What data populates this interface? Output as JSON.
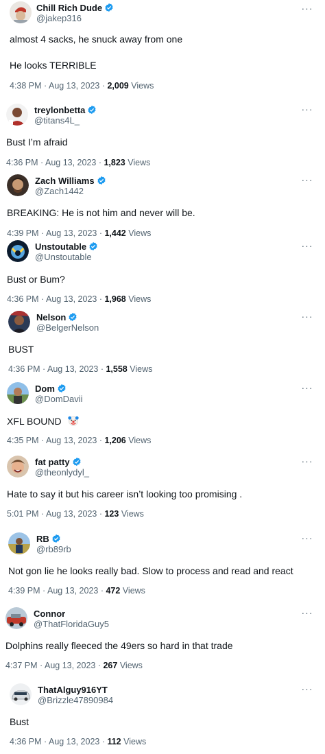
{
  "colors": {
    "verified": "#1d9bf0",
    "secondary": "#536471",
    "text": "#0f1419"
  },
  "icons": {
    "verified": "verified-badge-icon",
    "more": "more-options-icon"
  },
  "tweets": [
    {
      "name": "Chill Rich Dude",
      "handle": "@jakep316",
      "verified": true,
      "lines": [
        "almost 4 sacks, he snuck away from one",
        "He looks TERRIBLE"
      ],
      "time": "4:38 PM",
      "date": "Aug 13, 2023",
      "views": "2,009",
      "views_label": "Views"
    },
    {
      "name": "treylonbetta",
      "handle": "@titans4L_",
      "verified": true,
      "lines": [
        "Bust I’m afraid"
      ],
      "time": "4:36 PM",
      "date": "Aug 13, 2023",
      "views": "1,823",
      "views_label": "Views"
    },
    {
      "name": "Zach Williams",
      "handle": "@Zach1442",
      "verified": true,
      "lines": [
        "BREAKING: He is not him and never will be."
      ],
      "time": "4:39 PM",
      "date": "Aug 13, 2023",
      "views": "1,442",
      "views_label": "Views"
    },
    {
      "name": "Unstoutable",
      "handle": "@Unstoutable",
      "verified": true,
      "lines": [
        "Bust or Bum?"
      ],
      "time": "4:36 PM",
      "date": "Aug 13, 2023",
      "views": "1,968",
      "views_label": "Views"
    },
    {
      "name": "Nelson",
      "handle": "@BelgerNelson",
      "verified": true,
      "lines": [
        "BUST"
      ],
      "time": "4:36 PM",
      "date": "Aug 13, 2023",
      "views": "1,558",
      "views_label": "Views"
    },
    {
      "name": "Dom",
      "handle": "@DomDavii",
      "verified": true,
      "lines": [
        "XFL BOUND"
      ],
      "emoji": "clown-face-emoji",
      "time": "4:35 PM",
      "date": "Aug 13, 2023",
      "views": "1,206",
      "views_label": "Views"
    },
    {
      "name": "fat patty",
      "handle": "@theonlydyl_",
      "verified": true,
      "lines": [
        "Hate to say it but his career isn’t looking too promising ."
      ],
      "time": "5:01 PM",
      "date": "Aug 13, 2023",
      "views": "123",
      "views_label": "Views"
    },
    {
      "name": "RB",
      "handle": "@rb89rb",
      "verified": true,
      "lines": [
        "Not gon lie he looks really bad. Slow to process and read and react"
      ],
      "time": "4:39 PM",
      "date": "Aug 13, 2023",
      "views": "472",
      "views_label": "Views"
    },
    {
      "name": "Connor",
      "handle": "@ThatFloridaGuy5",
      "verified": false,
      "lines": [
        "Dolphins really fleeced the 49ers so hard in that trade"
      ],
      "time": "4:37 PM",
      "date": "Aug 13, 2023",
      "views": "267",
      "views_label": "Views"
    },
    {
      "name": "ThatAlguy916YT",
      "handle": "@Brizzle47890984",
      "verified": false,
      "lines": [
        "Bust"
      ],
      "time": "4:36 PM",
      "date": "Aug 13, 2023",
      "views": "112",
      "views_label": "Views"
    }
  ]
}
